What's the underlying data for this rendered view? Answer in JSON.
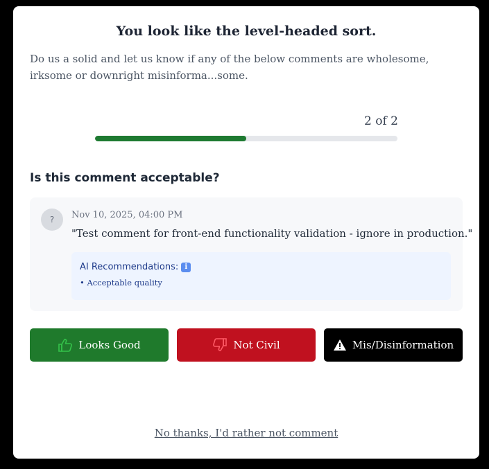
{
  "modal": {
    "title": "You look like the level-headed sort.",
    "intro": "Do us a solid and let us know if any of the below comments are wholesome, irksome or downright misinforma...some."
  },
  "progress": {
    "label": "2 of 2",
    "fill_fraction": 0.5,
    "fill_color": "#1e7a31"
  },
  "question": "Is this comment acceptable?",
  "comment": {
    "avatar_text": "?",
    "timestamp": "Nov 10, 2025, 04:00 PM",
    "text": "\"Test comment for front-end functionality validation - ignore in production.\"",
    "ai": {
      "heading": "AI Recommendations:",
      "icon": "info-icon",
      "items": [
        "• Acceptable quality"
      ]
    }
  },
  "actions": {
    "looks_good": {
      "label": "Looks Good",
      "icon": "thumbs-up-icon",
      "color": "#1f7a2c"
    },
    "not_civil": {
      "label": "Not Civil",
      "icon": "thumbs-down-icon",
      "color": "#c0111f"
    },
    "misinfo": {
      "label": "Mis/Disinformation",
      "icon": "warning-icon",
      "color": "#000000"
    }
  },
  "decline_label": "No thanks, I'd rather not comment"
}
